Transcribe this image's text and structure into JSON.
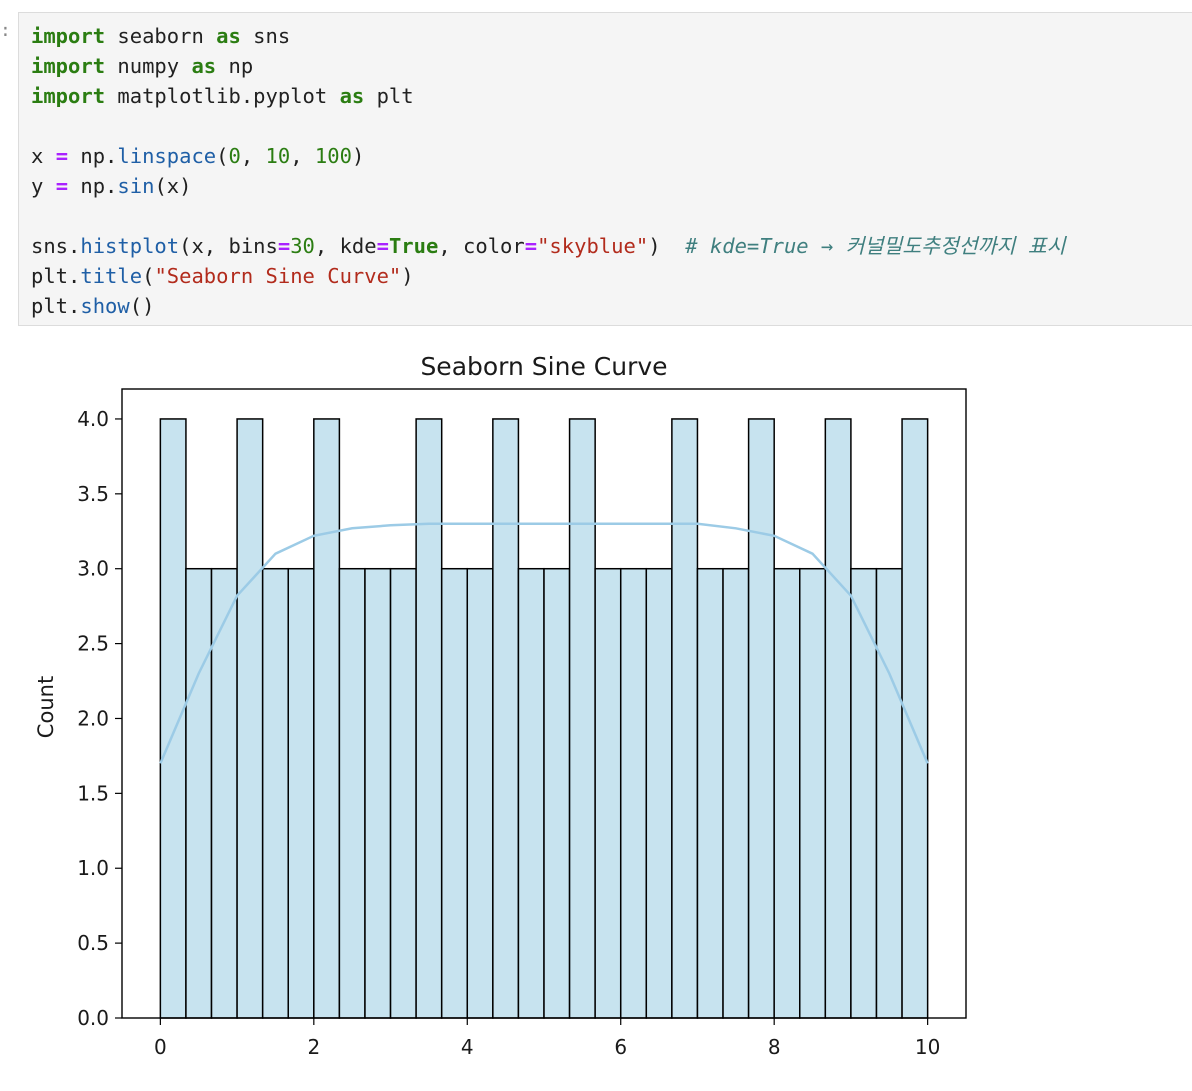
{
  "cell": {
    "prompt": ":",
    "code_lines": [
      [
        {
          "t": "import",
          "c": "kw"
        },
        {
          "t": " seaborn "
        },
        {
          "t": "as",
          "c": "kw"
        },
        {
          "t": " sns"
        }
      ],
      [
        {
          "t": "import",
          "c": "kw"
        },
        {
          "t": " numpy "
        },
        {
          "t": "as",
          "c": "kw"
        },
        {
          "t": " np"
        }
      ],
      [
        {
          "t": "import",
          "c": "kw"
        },
        {
          "t": " matplotlib.pyplot "
        },
        {
          "t": "as",
          "c": "kw"
        },
        {
          "t": " plt"
        }
      ],
      [],
      [
        {
          "t": "x "
        },
        {
          "t": "=",
          "c": "op"
        },
        {
          "t": " np."
        },
        {
          "t": "linspace",
          "c": "fn"
        },
        {
          "t": "("
        },
        {
          "t": "0",
          "c": "num"
        },
        {
          "t": ", "
        },
        {
          "t": "10",
          "c": "num"
        },
        {
          "t": ", "
        },
        {
          "t": "100",
          "c": "num"
        },
        {
          "t": ")"
        }
      ],
      [
        {
          "t": "y "
        },
        {
          "t": "=",
          "c": "op"
        },
        {
          "t": " np."
        },
        {
          "t": "sin",
          "c": "fn"
        },
        {
          "t": "(x)"
        }
      ],
      [],
      [
        {
          "t": "sns."
        },
        {
          "t": "histplot",
          "c": "fn"
        },
        {
          "t": "(x, bins"
        },
        {
          "t": "=",
          "c": "op"
        },
        {
          "t": "30",
          "c": "num"
        },
        {
          "t": ", kde"
        },
        {
          "t": "=",
          "c": "op"
        },
        {
          "t": "True",
          "c": "kw"
        },
        {
          "t": ", color"
        },
        {
          "t": "=",
          "c": "op"
        },
        {
          "t": "\"skyblue\"",
          "c": "str"
        },
        {
          "t": ")  "
        },
        {
          "t": "# kde=True → 커널밀도추정선까지 표시",
          "c": "com"
        }
      ],
      [
        {
          "t": "plt."
        },
        {
          "t": "title",
          "c": "fn"
        },
        {
          "t": "("
        },
        {
          "t": "\"Seaborn Sine Curve\"",
          "c": "str"
        },
        {
          "t": ")"
        }
      ],
      [
        {
          "t": "plt."
        },
        {
          "t": "show",
          "c": "fn"
        },
        {
          "t": "()"
        }
      ]
    ]
  },
  "chart_data": {
    "type": "bar",
    "title": "Seaborn Sine Curve",
    "xlabel": "",
    "ylabel": "Count",
    "bins": 30,
    "x_range": [
      0,
      10
    ],
    "xlim": [
      -0.5,
      10.5
    ],
    "ylim": [
      0,
      4.2
    ],
    "counts": [
      4,
      3,
      3,
      4,
      3,
      3,
      4,
      3,
      3,
      3,
      4,
      3,
      3,
      4,
      3,
      3,
      4,
      3,
      3,
      3,
      4,
      3,
      3,
      4,
      3,
      3,
      4,
      3,
      3,
      4
    ],
    "xticks": [
      0,
      2,
      4,
      6,
      8,
      10
    ],
    "yticks": [
      0.0,
      0.5,
      1.0,
      1.5,
      2.0,
      2.5,
      3.0,
      3.5,
      4.0
    ],
    "ytick_labels": [
      "0.0",
      "0.5",
      "1.0",
      "1.5",
      "2.0",
      "2.5",
      "3.0",
      "3.5",
      "4.0"
    ],
    "kde": {
      "x": [
        0,
        0.5,
        1,
        1.5,
        2,
        2.5,
        3,
        3.5,
        4,
        5,
        6,
        7,
        7.5,
        8,
        8.5,
        9,
        9.5,
        10
      ],
      "y": [
        1.7,
        2.3,
        2.82,
        3.1,
        3.22,
        3.27,
        3.29,
        3.3,
        3.3,
        3.3,
        3.3,
        3.3,
        3.27,
        3.22,
        3.1,
        2.82,
        2.3,
        1.7
      ]
    },
    "bar_fill": "#c7e3ef",
    "bar_edge": "#000000",
    "kde_color": "#9ccbe6",
    "grid": false
  }
}
